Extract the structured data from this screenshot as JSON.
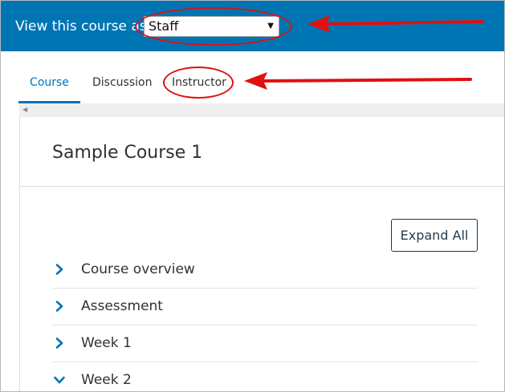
{
  "header": {
    "view_as_label": "View this course as:",
    "view_as_selected": "Staff",
    "caret": "▼"
  },
  "tabs": [
    {
      "label": "Course",
      "active": true
    },
    {
      "label": "Discussion",
      "active": false
    },
    {
      "label": "Instructor",
      "active": false
    }
  ],
  "course": {
    "title": "Sample Course 1",
    "expand_all_label": "Expand All",
    "sections": [
      {
        "label": "Course overview",
        "expanded": false
      },
      {
        "label": "Assessment",
        "expanded": false
      },
      {
        "label": "Week 1",
        "expanded": false
      },
      {
        "label": "Week 2",
        "expanded": true
      }
    ]
  },
  "icons": {
    "section_collapsed": "chevron-right-icon",
    "section_expanded": "chevron-down-icon",
    "scroll_left": "triangle-left-icon"
  },
  "colors": {
    "brand_blue": "#0075b4",
    "annotation_red": "#e01010",
    "text_dark": "#313131"
  }
}
